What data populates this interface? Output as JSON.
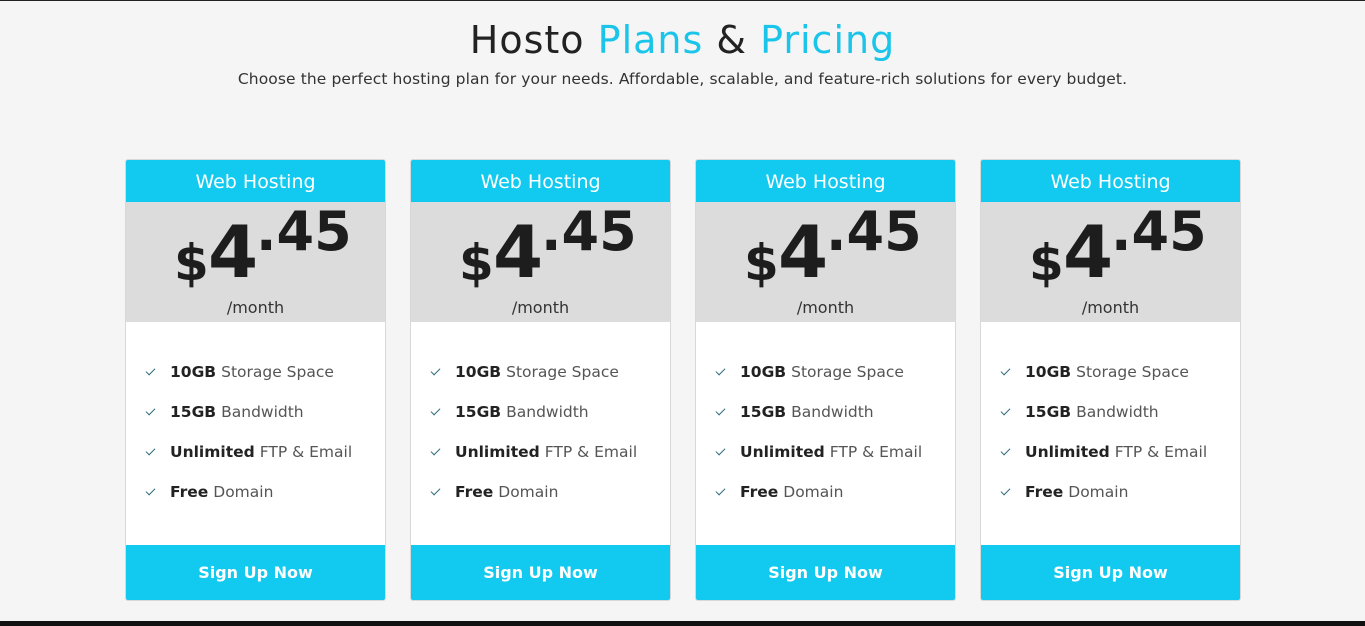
{
  "header": {
    "title_part1": "Hosto",
    "title_part2": "Plans",
    "title_amp": "&",
    "title_part3": "Pricing",
    "subtitle": "Choose the perfect hosting plan for your needs. Affordable, scalable, and feature-rich solutions for every budget."
  },
  "colors": {
    "accent": "#1bc5ea",
    "card_header": "#12caef",
    "price_band": "#dcdcdc",
    "page_bg": "#f5f5f5"
  },
  "plans": [
    {
      "name": "Web Hosting",
      "currency": "$",
      "price_int": "4",
      "price_dec": ".45",
      "period": "/month",
      "features": [
        {
          "bold": "10GB",
          "text": "Storage Space"
        },
        {
          "bold": "15GB",
          "text": "Bandwidth"
        },
        {
          "bold": "Unlimited",
          "text": "FTP & Email"
        },
        {
          "bold": "Free",
          "text": "Domain"
        }
      ],
      "cta": "Sign Up Now"
    },
    {
      "name": "Web Hosting",
      "currency": "$",
      "price_int": "4",
      "price_dec": ".45",
      "period": "/month",
      "features": [
        {
          "bold": "10GB",
          "text": "Storage Space"
        },
        {
          "bold": "15GB",
          "text": "Bandwidth"
        },
        {
          "bold": "Unlimited",
          "text": "FTP & Email"
        },
        {
          "bold": "Free",
          "text": "Domain"
        }
      ],
      "cta": "Sign Up Now"
    },
    {
      "name": "Web Hosting",
      "currency": "$",
      "price_int": "4",
      "price_dec": ".45",
      "period": "/month",
      "features": [
        {
          "bold": "10GB",
          "text": "Storage Space"
        },
        {
          "bold": "15GB",
          "text": "Bandwidth"
        },
        {
          "bold": "Unlimited",
          "text": "FTP & Email"
        },
        {
          "bold": "Free",
          "text": "Domain"
        }
      ],
      "cta": "Sign Up Now"
    },
    {
      "name": "Web Hosting",
      "currency": "$",
      "price_int": "4",
      "price_dec": ".45",
      "period": "/month",
      "features": [
        {
          "bold": "10GB",
          "text": "Storage Space"
        },
        {
          "bold": "15GB",
          "text": "Bandwidth"
        },
        {
          "bold": "Unlimited",
          "text": "FTP & Email"
        },
        {
          "bold": "Free",
          "text": "Domain"
        }
      ],
      "cta": "Sign Up Now"
    }
  ]
}
